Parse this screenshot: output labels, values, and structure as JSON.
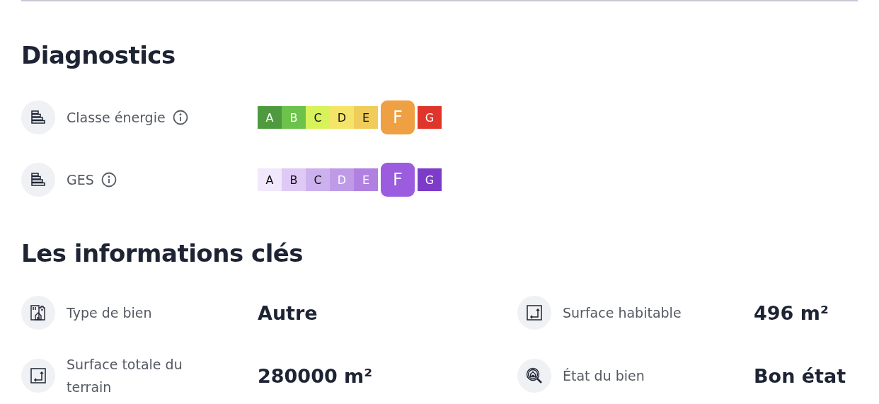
{
  "diagnostics": {
    "title": "Diagnostics",
    "rows": [
      {
        "label": "Classe énergie",
        "grades": [
          {
            "letter": "A",
            "color": "#4f9a3e",
            "selected": false
          },
          {
            "letter": "B",
            "color": "#6cc24a",
            "selected": false
          },
          {
            "letter": "C",
            "color": "#d8f35a",
            "selected": false
          },
          {
            "letter": "D",
            "color": "#f5e46a",
            "selected": false
          },
          {
            "letter": "E",
            "color": "#f0cd5a",
            "selected": false
          },
          {
            "letter": "F",
            "color": "#eea043",
            "selected": true
          },
          {
            "letter": "G",
            "color": "#e0352b",
            "selected": false
          }
        ]
      },
      {
        "label": "GES",
        "grades": [
          {
            "letter": "A",
            "color": "#f1e9fb",
            "selected": false
          },
          {
            "letter": "B",
            "color": "#dfc9f5",
            "selected": false
          },
          {
            "letter": "C",
            "color": "#cdb0ee",
            "selected": false
          },
          {
            "letter": "D",
            "color": "#bf9be7",
            "selected": false
          },
          {
            "letter": "E",
            "color": "#b181e2",
            "selected": false
          },
          {
            "letter": "F",
            "color": "#9b5ce0",
            "selected": true
          },
          {
            "letter": "G",
            "color": "#7c3bc9",
            "selected": false
          }
        ]
      }
    ]
  },
  "key_info": {
    "title": "Les informations clés",
    "items": [
      {
        "kind": "building",
        "label": "Type de bien",
        "value": "Autre"
      },
      {
        "kind": "surface",
        "label": "Surface habitable",
        "value": "496 m²"
      },
      {
        "kind": "surface",
        "label": "Surface totale du terrain",
        "value": "280000 m²"
      },
      {
        "kind": "inspect",
        "label": "État du bien",
        "value": "Bon état"
      }
    ]
  }
}
